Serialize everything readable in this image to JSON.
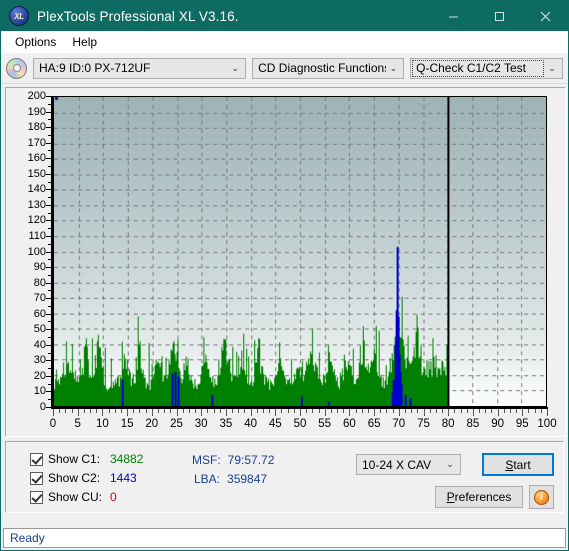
{
  "window": {
    "title": "PlexTools Professional XL V3.16.",
    "icon": "xl-app-icon",
    "minimize_label": "─",
    "maximize_label": "□",
    "close_label": "✕"
  },
  "menubar": {
    "items": [
      {
        "label": "Options"
      },
      {
        "label": "Help"
      }
    ]
  },
  "toolbar": {
    "disc_icon": "cd-disc-icon",
    "drive": {
      "value": "HA:9 ID:0  PX-712UF",
      "arrow": "⌄"
    },
    "function": {
      "value": "CD Diagnostic Functions",
      "arrow": "⌄"
    },
    "test": {
      "value": "Q-Check C1/C2 Test",
      "arrow": "⌄"
    }
  },
  "legend": {
    "c1": {
      "label": "Show C1:",
      "value": "34882",
      "color": "#008000",
      "checked": true
    },
    "c2": {
      "label": "Show C2:",
      "value": "1443",
      "color": "#0000cd",
      "checked": true
    },
    "cu": {
      "label": "Show CU:",
      "value": "0",
      "color": "#d40000",
      "checked": true
    }
  },
  "readouts": {
    "msf": {
      "key": "MSF:",
      "value": "79:57.72"
    },
    "lba": {
      "key": "LBA:",
      "value": "359847"
    }
  },
  "controls": {
    "speed": {
      "value": "10-24 X CAV",
      "arrow": "⌄"
    },
    "start": {
      "label": "Start",
      "accel": "S"
    },
    "preferences": {
      "label": "Preferences",
      "accel": "P"
    },
    "info": {
      "label": "i",
      "name": "info-icon"
    }
  },
  "statusbar": {
    "text": "Ready"
  },
  "chart_data": {
    "type": "bar",
    "title": "",
    "xlabel": "",
    "ylabel": "",
    "xlim": [
      0,
      100
    ],
    "ylim": [
      0,
      200
    ],
    "xticks": [
      0,
      5,
      10,
      15,
      20,
      25,
      30,
      35,
      40,
      45,
      50,
      55,
      60,
      65,
      70,
      75,
      80,
      85,
      90,
      95,
      100
    ],
    "yticks": [
      0,
      10,
      20,
      30,
      40,
      50,
      60,
      70,
      80,
      90,
      100,
      110,
      120,
      130,
      140,
      150,
      160,
      170,
      180,
      190,
      200
    ],
    "grid": true,
    "grid_style": "dashed",
    "data_end_x": 80,
    "marker_line_x": 80,
    "marker_line_color": "#000000",
    "corner_marker": {
      "x": 0,
      "y": 200,
      "color": "#1010b0"
    },
    "plot_bg_top": "#9db3b6",
    "plot_bg_bottom": "#fbfcfc",
    "series": [
      {
        "name": "C1",
        "color": "#008000",
        "baseline": 9,
        "noise": 9,
        "seed": 20117,
        "spike_rate": 0.16,
        "spike_scale": 26,
        "bumps": [
          {
            "center": 3.2,
            "width": 1.3,
            "amp": 14
          },
          {
            "center": 6.3,
            "width": 0.9,
            "amp": 20
          },
          {
            "center": 8.9,
            "width": 1.0,
            "amp": 22
          },
          {
            "center": 14.4,
            "width": 0.8,
            "amp": 18
          },
          {
            "center": 17.1,
            "width": 1.0,
            "amp": 14
          },
          {
            "center": 21.2,
            "width": 1.1,
            "amp": 16
          },
          {
            "center": 24.2,
            "width": 1.1,
            "amp": 22
          },
          {
            "center": 27.0,
            "width": 0.8,
            "amp": 18
          },
          {
            "center": 30.7,
            "width": 1.0,
            "amp": 16
          },
          {
            "center": 34.7,
            "width": 1.0,
            "amp": 28
          },
          {
            "center": 38.0,
            "width": 0.9,
            "amp": 14
          },
          {
            "center": 41.6,
            "width": 1.1,
            "amp": 16
          },
          {
            "center": 45.8,
            "width": 0.9,
            "amp": 14
          },
          {
            "center": 49.5,
            "width": 1.0,
            "amp": 13
          },
          {
            "center": 52.4,
            "width": 1.3,
            "amp": 22
          },
          {
            "center": 56.0,
            "width": 1.0,
            "amp": 16
          },
          {
            "center": 59.5,
            "width": 1.1,
            "amp": 17
          },
          {
            "center": 62.8,
            "width": 1.2,
            "amp": 14
          },
          {
            "center": 65.1,
            "width": 1.1,
            "amp": 20
          },
          {
            "center": 69.8,
            "width": 1.6,
            "amp": 34
          },
          {
            "center": 73.6,
            "width": 1.6,
            "amp": 26
          },
          {
            "center": 77.0,
            "width": 1.2,
            "amp": 16
          },
          {
            "center": 79.2,
            "width": 0.9,
            "amp": 14
          }
        ],
        "peaks": [
          {
            "x": 6.4,
            "value": 44
          },
          {
            "x": 9.0,
            "value": 46
          },
          {
            "x": 17.4,
            "value": 42
          },
          {
            "x": 24.3,
            "value": 42
          },
          {
            "x": 34.8,
            "value": 43
          },
          {
            "x": 52.5,
            "value": 50
          },
          {
            "x": 69.7,
            "value": 54
          },
          {
            "x": 73.5,
            "value": 48
          }
        ]
      },
      {
        "name": "C2",
        "color": "#0000cd",
        "baseline": 0,
        "noise": 0,
        "seed": 77341,
        "spikes": [
          {
            "x": 13.8,
            "value": 17
          },
          {
            "x": 23.9,
            "value": 21
          },
          {
            "x": 24.5,
            "value": 22
          },
          {
            "x": 25.0,
            "value": 19
          },
          {
            "x": 31.9,
            "value": 7
          },
          {
            "x": 50.2,
            "value": 6
          },
          {
            "x": 55.6,
            "value": 3
          },
          {
            "x": 68.6,
            "value": 9
          },
          {
            "x": 68.9,
            "value": 17
          },
          {
            "x": 69.2,
            "value": 40
          },
          {
            "x": 69.4,
            "value": 62
          },
          {
            "x": 69.6,
            "value": 103
          },
          {
            "x": 69.8,
            "value": 58
          },
          {
            "x": 70.0,
            "value": 33
          },
          {
            "x": 70.2,
            "value": 22
          },
          {
            "x": 70.5,
            "value": 14
          },
          {
            "x": 71.2,
            "value": 7
          },
          {
            "x": 72.3,
            "value": 5
          }
        ]
      },
      {
        "name": "CU",
        "color": "#d40000",
        "baseline": 0,
        "noise": 0,
        "seed": 5,
        "spikes": []
      }
    ]
  }
}
